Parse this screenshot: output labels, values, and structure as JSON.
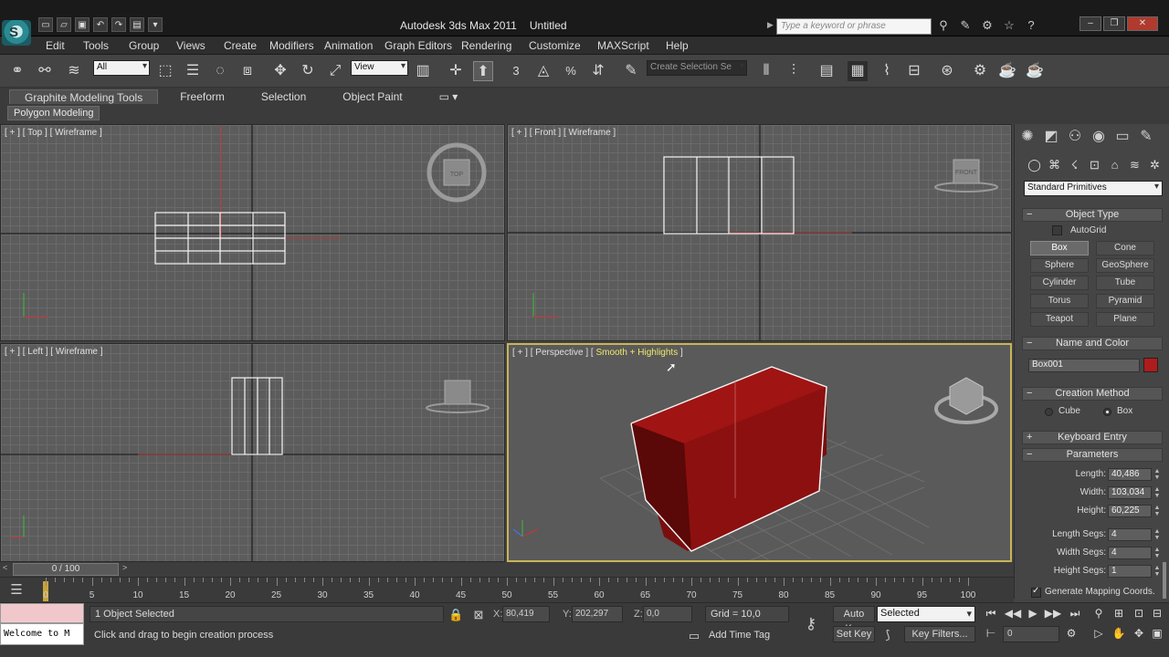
{
  "app": {
    "title": "Autodesk 3ds Max  2011",
    "document": "Untitled",
    "logo_letter": "S",
    "search_placeholder": "Type a keyword or phrase"
  },
  "menu": [
    "Edit",
    "Tools",
    "Group",
    "Views",
    "Create",
    "Modifiers",
    "Animation",
    "Graph Editors",
    "Rendering",
    "Customize",
    "MAXScript",
    "Help"
  ],
  "toolbar": {
    "selection_filter": "All",
    "reference_coord": "View",
    "named_selection": "Create Selection Se",
    "snap_label": "3",
    "angle_snap_label": "%"
  },
  "ribbon": {
    "tabs": [
      "Graphite Modeling Tools",
      "Freeform",
      "Selection",
      "Object Paint"
    ],
    "panel": "Polygon Modeling"
  },
  "viewports": {
    "top": "[ + ] [ Top ] [ Wireframe ]",
    "front": "[ + ] [ Front ] [ Wireframe ]",
    "left": "[ + ] [ Left ] [ Wireframe ]",
    "perspective_prefix": "[ + ] [ Perspective ] [",
    "perspective_shading": "Smooth + Highlights",
    "perspective_suffix": "]",
    "viewcube_top": "TOP",
    "viewcube_front": "FRONT"
  },
  "command_panel": {
    "primitive_type": "Standard Primitives",
    "object_type_title": "Object Type",
    "autogrid": "AutoGrid",
    "buttons": [
      "Box",
      "Cone",
      "Sphere",
      "GeoSphere",
      "Cylinder",
      "Tube",
      "Torus",
      "Pyramid",
      "Teapot",
      "Plane"
    ],
    "name_color_title": "Name and Color",
    "object_name": "Box001",
    "object_color": "#b01c1c",
    "creation_method_title": "Creation Method",
    "creation_cube": "Cube",
    "creation_box": "Box",
    "keyboard_entry_title": "Keyboard Entry",
    "parameters_title": "Parameters",
    "length_label": "Length:",
    "length_value": "40,486",
    "width_label": "Width:",
    "width_value": "103,034",
    "height_label": "Height:",
    "height_value": "60,225",
    "length_segs_label": "Length Segs:",
    "length_segs_value": "4",
    "width_segs_label": "Width Segs:",
    "width_segs_value": "4",
    "height_segs_label": "Height Segs:",
    "height_segs_value": "1",
    "gen_mapping": "Generate Mapping Coords."
  },
  "timeline": {
    "slider": "0 / 100",
    "ticks": [
      "0",
      "5",
      "10",
      "15",
      "20",
      "25",
      "30",
      "35",
      "40",
      "45",
      "50",
      "55",
      "60",
      "65",
      "70",
      "75",
      "80",
      "85",
      "90",
      "95",
      "100"
    ]
  },
  "status": {
    "maxscript": "Welcome to M",
    "selected": "1 Object Selected",
    "prompt": "Click and drag to begin creation process",
    "x_label": "X:",
    "x_value": "80,419",
    "y_label": "Y:",
    "y_value": "202,297",
    "z_label": "Z:",
    "z_value": "0,0",
    "grid": "Grid = 10,0",
    "add_time_tag": "Add Time Tag",
    "auto_key": "Auto Key",
    "set_key": "Set Key",
    "key_mode": "Selected",
    "key_filters": "Key Filters...",
    "frame": "0"
  }
}
